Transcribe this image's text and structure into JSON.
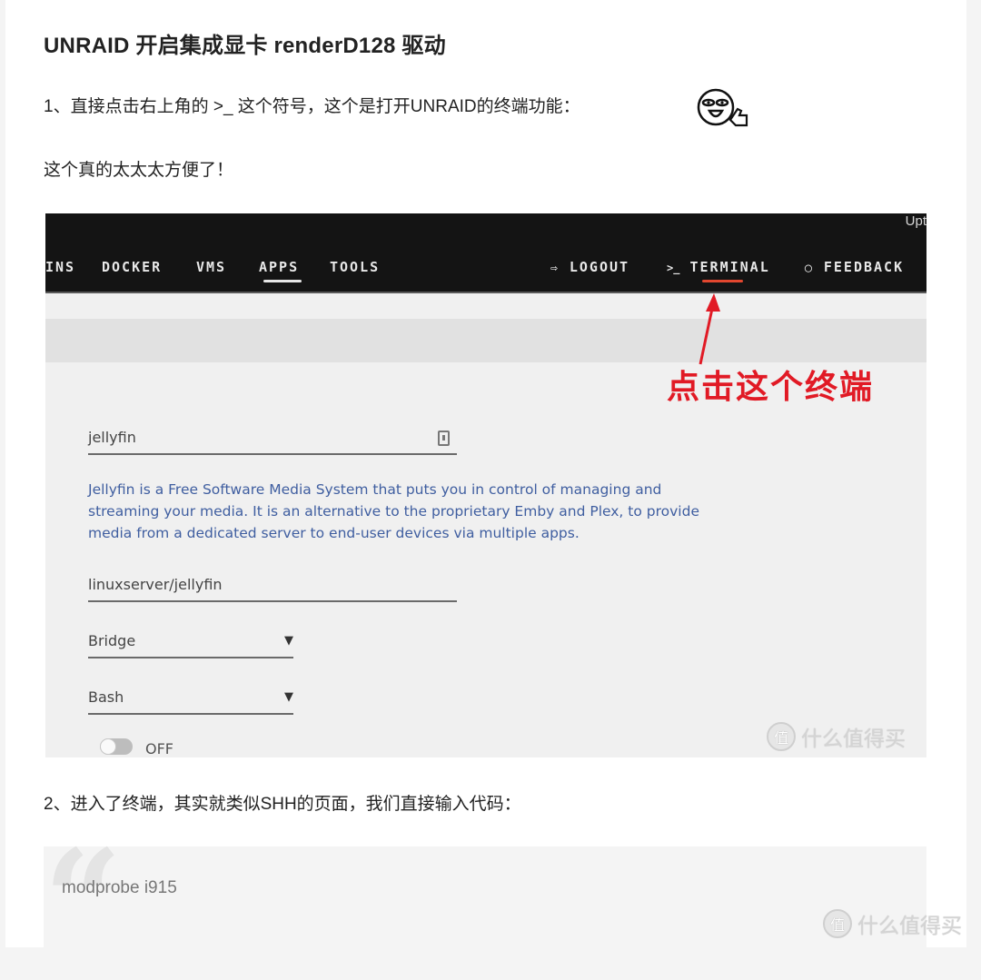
{
  "article": {
    "title": "UNRAID 开启集成显卡 renderD128 驱动",
    "step1": "1、直接点击右上角的 >_  这个符号，这个是打开UNRAID的终端功能：",
    "remark": "这个真的太太太方便了！",
    "step2": "2、进入了终端，其实就类似SHH的页面，我们直接输入代码：",
    "code": "modprobe i915",
    "emoji_icon": "thumbs-up-face-emoji"
  },
  "screenshot": {
    "uptime_label": "Upt",
    "nav": {
      "items": [
        {
          "label": "INS"
        },
        {
          "label": "DOCKER"
        },
        {
          "label": "VMS"
        },
        {
          "label": "APPS",
          "active": true
        },
        {
          "label": "TOOLS"
        }
      ],
      "actions": [
        {
          "label": "LOGOUT",
          "icon": "logout-icon"
        },
        {
          "label": "TERMINAL",
          "icon": "terminal-prompt-icon",
          "icon_text": ">_",
          "highlighted": true
        },
        {
          "label": "FEEDBACK",
          "icon": "speech-bubble-icon"
        }
      ],
      "accent_color": "#e2472f"
    },
    "annotation": "点击这个终端",
    "annotation_color": "#e11a25",
    "form": {
      "name_value": "jellyfin",
      "description": "Jellyfin is a Free Software Media System that puts you in control of managing and streaming your media. It is an alternative to the proprietary Emby and Plex, to provide media from a dedicated server to end-user devices via multiple apps.",
      "repository_value": "linuxserver/jellyfin",
      "network_value": "Bridge",
      "shell_value": "Bash",
      "toggle_label": "OFF",
      "toggle_on": false
    }
  },
  "watermark": {
    "badge": "值",
    "text": "什么值得买"
  }
}
